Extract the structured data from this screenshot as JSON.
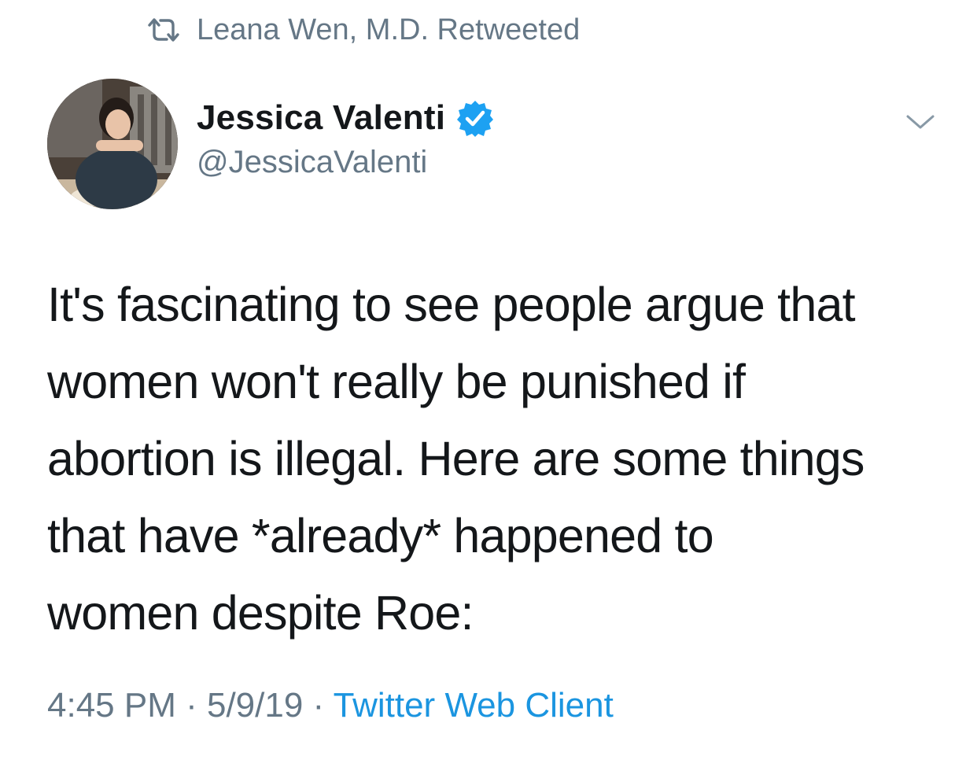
{
  "retweet": {
    "icon": "retweet-icon",
    "text": "Leana Wen, M.D. Retweeted"
  },
  "author": {
    "name": "Jessica Valenti",
    "handle": "@JessicaValenti",
    "verified_icon": "verified-badge-icon",
    "avatar_icon": "avatar-photo"
  },
  "menu": {
    "icon": "chevron-down-icon"
  },
  "tweet": {
    "lines": [
      "It's fascinating to see people argue that",
      "women won't really be punished if",
      "abortion is illegal. Here are some things",
      "that have *already* happened to",
      "women despite Roe:"
    ]
  },
  "meta": {
    "time": "4:45 PM",
    "separator": " · ",
    "date": "5/9/19",
    "source": "Twitter Web Client"
  },
  "colors": {
    "text_primary": "#14171a",
    "text_secondary": "#657786",
    "link": "#1b95e0",
    "verified": "#1da1f2"
  }
}
